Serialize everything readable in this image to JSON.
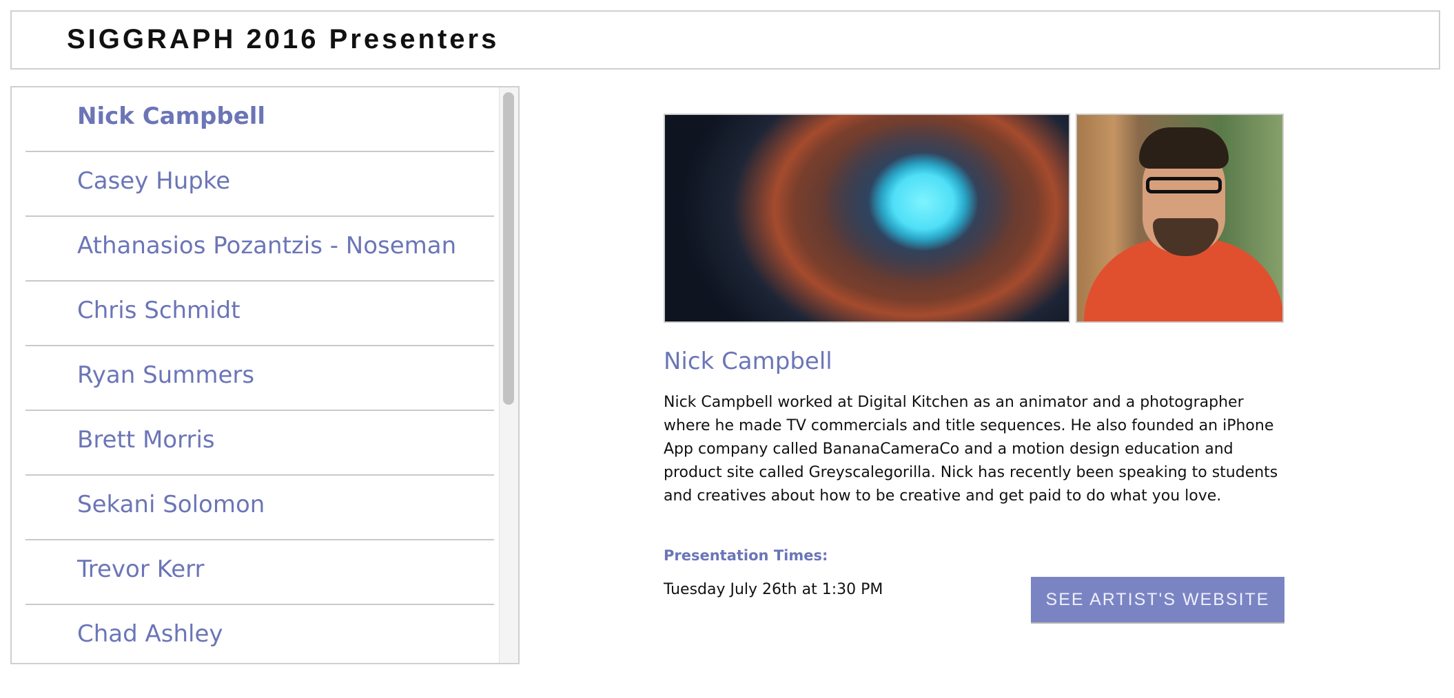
{
  "header": {
    "title": "SIGGRAPH 2016 Presenters"
  },
  "presenters": {
    "items": [
      {
        "label": "Nick Campbell",
        "active": true
      },
      {
        "label": "Casey Hupke"
      },
      {
        "label": "Athanasios Pozantzis - Noseman"
      },
      {
        "label": "Chris Schmidt"
      },
      {
        "label": "Ryan Summers"
      },
      {
        "label": "Brett Morris"
      },
      {
        "label": "Sekani Solomon"
      },
      {
        "label": "Trevor Kerr"
      },
      {
        "label": "Chad Ashley"
      }
    ]
  },
  "detail": {
    "name": "Nick Campbell",
    "bio": "Nick Campbell worked at Digital Kitchen as an animator and a photographer where he made TV commercials and title sequences. He also founded an iPhone App company called BananaCameraCo and a motion design education and product site called Greyscalegorilla. Nick has recently been speaking to students and creatives about how to be creative and get paid to do what you love.",
    "times_label": "Presentation Times:",
    "times_value": "Tuesday July 26th at 1:30 PM",
    "website_button": "SEE ARTIST'S WEBSITE"
  },
  "colors": {
    "accent": "#6b75b7",
    "button": "#7b84c3",
    "border": "#cfcfcf"
  }
}
